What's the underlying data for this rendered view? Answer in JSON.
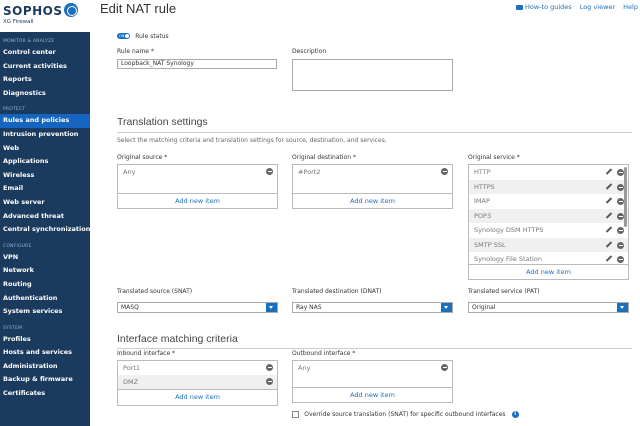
{
  "brand": {
    "name": "SOPHOS",
    "product": "XG Firewall"
  },
  "sidebar": {
    "sections": [
      {
        "title": "MONITOR & ANALYZE",
        "items": [
          "Control center",
          "Current activities",
          "Reports",
          "Diagnostics"
        ]
      },
      {
        "title": "PROTECT",
        "items": [
          "Rules and policies",
          "Intrusion prevention",
          "Web",
          "Applications",
          "Wireless",
          "Email",
          "Web server",
          "Advanced threat",
          "Central synchronization"
        ]
      },
      {
        "title": "CONFIGURE",
        "items": [
          "VPN",
          "Network",
          "Routing",
          "Authentication",
          "System services"
        ]
      },
      {
        "title": "SYSTEM",
        "items": [
          "Profiles",
          "Hosts and services",
          "Administration",
          "Backup & firmware",
          "Certificates"
        ]
      }
    ],
    "active": "Rules and policies"
  },
  "header": {
    "title": "Edit NAT rule",
    "links": {
      "how_to": "How-to guides",
      "log_viewer": "Log viewer",
      "help": "Help"
    }
  },
  "form": {
    "rule_status": {
      "label": "Rule status",
      "toggle_text": "ON",
      "enabled": true
    },
    "rule_name": {
      "label": "Rule name *",
      "value": "Loopback_NAT Synology"
    },
    "description": {
      "label": "Description",
      "value": ""
    }
  },
  "translation": {
    "title": "Translation settings",
    "hint": "Select the matching criteria and translation settings for source, destination, and services.",
    "original_source": {
      "label": "Original source *",
      "items": [
        "Any"
      ],
      "add": "Add new item"
    },
    "original_destination": {
      "label": "Original destination *",
      "items": [
        "#Port2"
      ],
      "add": "Add new item"
    },
    "original_service": {
      "label": "Original service *",
      "items": [
        "HTTP",
        "HTTPS",
        "IMAP",
        "POP3",
        "Synology DSM HTTPS",
        "SMTP SSL",
        "Synology File Station"
      ],
      "add": "Add new item"
    },
    "translated_source": {
      "label": "Translated source (SNAT)",
      "value": "MASQ"
    },
    "translated_destination": {
      "label": "Translated destination (DNAT)",
      "value": "Ray NAS"
    },
    "translated_service": {
      "label": "Translated service (PAT)",
      "value": "Original"
    }
  },
  "interface": {
    "title": "Interface matching criteria",
    "inbound": {
      "label": "Inbound interface *",
      "items": [
        "Port1",
        "DMZ"
      ],
      "add": "Add new item"
    },
    "outbound": {
      "label": "Outbound interface *",
      "items": [
        "Any"
      ],
      "add": "Add new item"
    },
    "override": {
      "label": "Override source translation (SNAT) for specific outbound interfaces",
      "checked": false
    }
  },
  "colors": {
    "sidebar_bg": "#1a3a5e",
    "accent": "#1a6fbf",
    "active_nav": "#1565c0"
  },
  "icons": [
    "globe-logo-icon",
    "video-icon",
    "toggle-icon",
    "remove-icon",
    "pencil-icon",
    "dropdown-arrow-icon",
    "info-icon"
  ]
}
